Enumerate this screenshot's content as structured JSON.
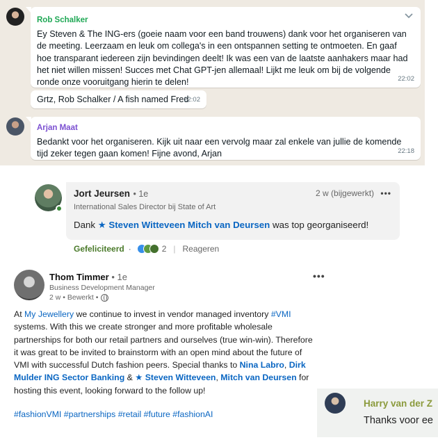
{
  "whatsapp": {
    "messages": [
      {
        "sender": "Rob Schalker",
        "text": "Ey Steven & The ING-ers (goeie naam voor een band trouwens) dank voor het organiseren van de meeting.  Leerzaam en leuk om collega's in een ontspannen setting te ontmoeten. En gaaf hoe transparant iedereen zijn bevindingen deelt! Ik was een van de laatste aanhakers maar had het niet willen missen! Succes met Chat GPT-jen allemaal! Lijkt me leuk om bij de volgende ronde onze vooruitgang hierin te delen!",
        "time": "22:02"
      },
      {
        "text": "Grtz, Rob Schalker / A fish named Fred",
        "time": "22:02"
      },
      {
        "sender": "Arjan Maat",
        "text": "Bedankt voor het organiseren. Kijk uit naar een vervolg maar zal enkele van jullie de komende tijd zeker tegen gaan komen! Fijne avond, Arjan",
        "time": "22:18"
      }
    ]
  },
  "comment": {
    "name": "Jort Jeursen",
    "degree": "• 1e",
    "meta": "2 w (bijgewerkt)",
    "title": "International Sales Director bij State of Art",
    "text_prefix": "Dank",
    "mention_star": "★",
    "mention_names": "Steven Witteveen Mitch van Deursen",
    "text_suffix": "was top georganiseerd!",
    "liked_label": "Gefeliciteerd",
    "dot_sep": "·",
    "reaction_count": "2",
    "sep": "|",
    "reply_label": "Reageren",
    "dots": "•••"
  },
  "post": {
    "name": "Thom Timmer",
    "degree": "• 1e",
    "subtitle": "Business Development Manager",
    "time": "2 w • Bewerkt •",
    "dots": "•••",
    "body": {
      "p1": "At",
      "company": "My Jewellery",
      "p2": "we continue to invest in vendor managed inventory",
      "tag_vmi": "#VMI",
      "p3": "systems. With this we create stronger and more profitable wholesale partnerships for both our retail partners and ourselves (true win-win). Therefore it was great to be invited to brainstorm with an open mind about the future of VMI with successful Dutch fashion peers. Special thanks to",
      "m1": "Nina Labro",
      "comma1": ",",
      "m2": "Dirk Mulder",
      "m3": "ING Sector Banking",
      "amp": "&",
      "star": "★",
      "m4": "Steven Witteveen",
      "comma2": ",",
      "m5": "Mitch van Deursen",
      "p4": "for hosting this event, looking forward to the follow up!"
    },
    "hashtags": "#fashionVMI #partnerships #retail #future #fashionAI"
  },
  "harry": {
    "name": "Harry van der Z",
    "message": "Thanks voor ee"
  }
}
